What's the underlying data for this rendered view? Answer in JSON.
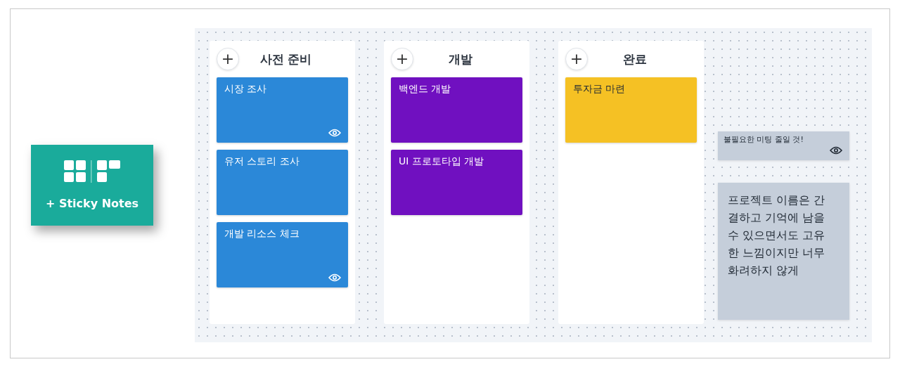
{
  "widget": {
    "label": "+ Sticky Notes"
  },
  "columns": [
    {
      "title": "사전 준비",
      "add_label": "+",
      "notes": [
        {
          "text": "시장 조사",
          "color": "#2b88d8",
          "watched": true
        },
        {
          "text": "유저 스토리 조사",
          "color": "#2b88d8",
          "watched": false
        },
        {
          "text": "개발 리소스 체크",
          "color": "#2b88d8",
          "watched": true
        }
      ]
    },
    {
      "title": "개발",
      "add_label": "+",
      "notes": [
        {
          "text": "백엔드 개발",
          "color": "#7010c0",
          "watched": false
        },
        {
          "text": "UI 프로토타입 개발",
          "color": "#7010c0",
          "watched": false
        }
      ]
    },
    {
      "title": "완료",
      "add_label": "+",
      "notes": [
        {
          "text": "투자금 마련",
          "color": "#f5c124",
          "watched": false
        }
      ]
    }
  ],
  "free_notes": [
    {
      "kind": "compact",
      "text": "불필요한 미팅 줄일 것!",
      "color": "#c5ceda",
      "watched": true
    },
    {
      "kind": "large",
      "text": "프로젝트 이름은 간결하고 기억에 남을 수 있으면서도 고유한 느낌이지만 너무 화려하지 않게",
      "color": "#c5ceda",
      "watched": false
    }
  ]
}
